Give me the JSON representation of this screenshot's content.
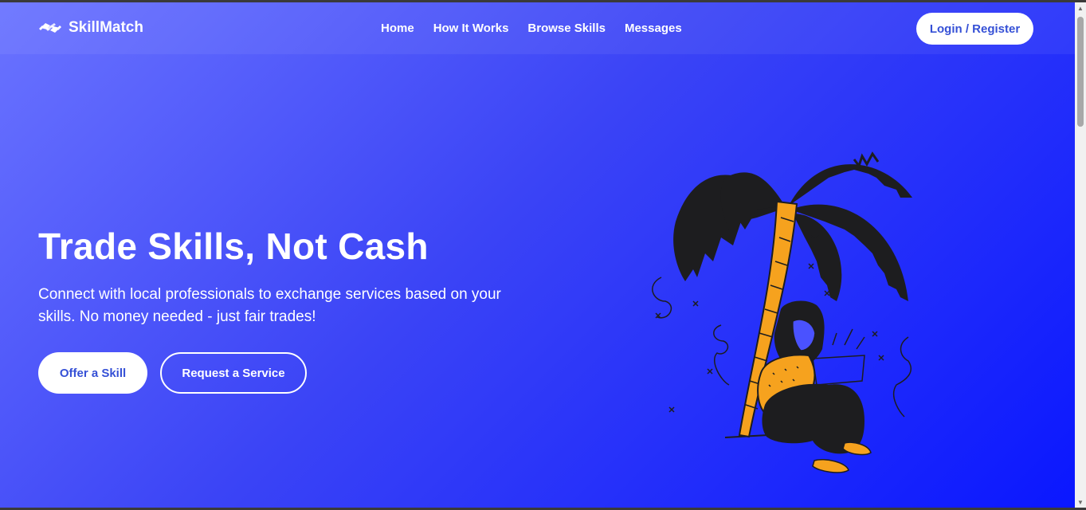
{
  "brand": {
    "name": "SkillMatch",
    "icon": "handshake-icon"
  },
  "nav": {
    "items": [
      {
        "label": "Home"
      },
      {
        "label": "How It Works"
      },
      {
        "label": "Browse Skills"
      },
      {
        "label": "Messages"
      }
    ],
    "login_label": "Login / Register"
  },
  "hero": {
    "title": "Trade Skills, Not Cash",
    "subtitle": "Connect with local professionals to exchange services based on your skills. No money needed - just fair trades!",
    "primary_button": "Offer a Skill",
    "secondary_button": "Request a Service",
    "illustration": "person-with-laptop-under-palm-tree"
  },
  "colors": {
    "gradient_start": "#6a73ff",
    "gradient_end": "#0a17ff",
    "accent_text": "#3550d6",
    "illustration_orange": "#f6a21e",
    "illustration_dark": "#1d1d1f"
  }
}
